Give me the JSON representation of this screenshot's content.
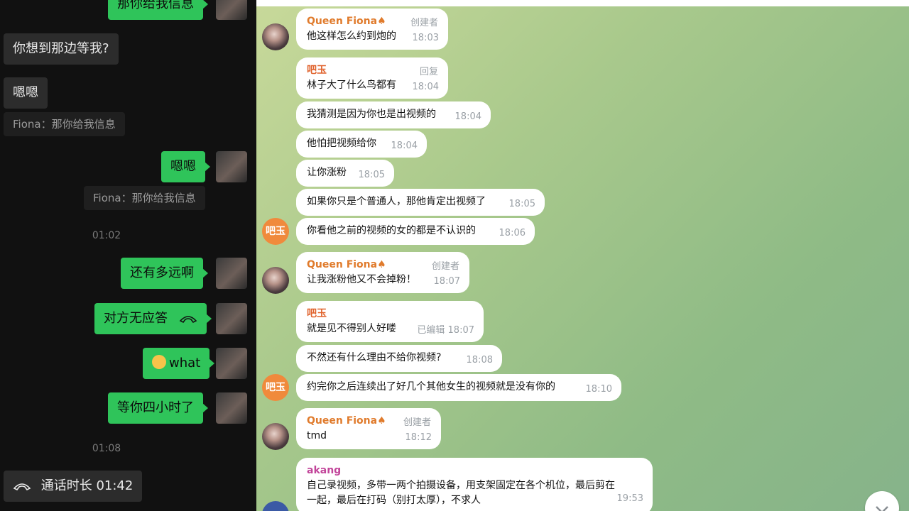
{
  "left": {
    "messages": {
      "m1": "那你给我信息",
      "m2": "你想到那边等我?",
      "m3": "嗯嗯",
      "q1": "Fiona：那你给我信息",
      "m4": "嗯嗯",
      "q2": "Fiona：那你给我信息",
      "t1": "01:02",
      "m5": "还有多远啊",
      "m6": "对方无应答",
      "m7": "what",
      "m8": "等你四小时了",
      "t2": "01:08",
      "call": "通话时长 01:42"
    }
  },
  "right": {
    "messages": [
      {
        "name": "Queen Fiona♠",
        "role": "创建者",
        "text": "他这样怎么约到炮的",
        "time": "18:03"
      },
      {
        "name": "吧玉",
        "role": "回复",
        "text": "林子大了什么鸟都有",
        "time": "18:04"
      },
      {
        "text": "我猜测是因为你也是出视频的",
        "time": "18:04"
      },
      {
        "text": "他怕把视频给你",
        "time": "18:04"
      },
      {
        "text": "让你涨粉",
        "time": "18:05"
      },
      {
        "text": "如果你只是个普通人，那他肯定出视频了",
        "time": "18:05"
      },
      {
        "text": "你看他之前的视频的女的都是不认识的",
        "time": "18:06"
      },
      {
        "name": "Queen Fiona♠",
        "role": "创建者",
        "text": "让我涨粉他又不会掉粉！",
        "time": "18:07"
      },
      {
        "name": "吧玉",
        "text": "就是见不得别人好喽",
        "time": "已编辑 18:07"
      },
      {
        "text": "不然还有什么理由不给你视频?",
        "time": "18:08"
      },
      {
        "text": "约完你之后连续出了好几个其他女生的视频就是没有你的",
        "time": "18:10"
      },
      {
        "name": "Queen Fiona♠",
        "role": "创建者",
        "text": "tmd",
        "time": "18:12"
      },
      {
        "name": "akang",
        "text": "自己录视频，多带一两个拍摄设备，用支架固定在各个机位，最后剪在",
        "text2": "一起，最后在打码（别打太厚），不求人",
        "time": "19:53"
      }
    ],
    "avatar_label": "吧玉",
    "colors": {
      "fiona": "#e07b2c",
      "bayu": "#e0622c",
      "akang": "#c2459a"
    }
  }
}
